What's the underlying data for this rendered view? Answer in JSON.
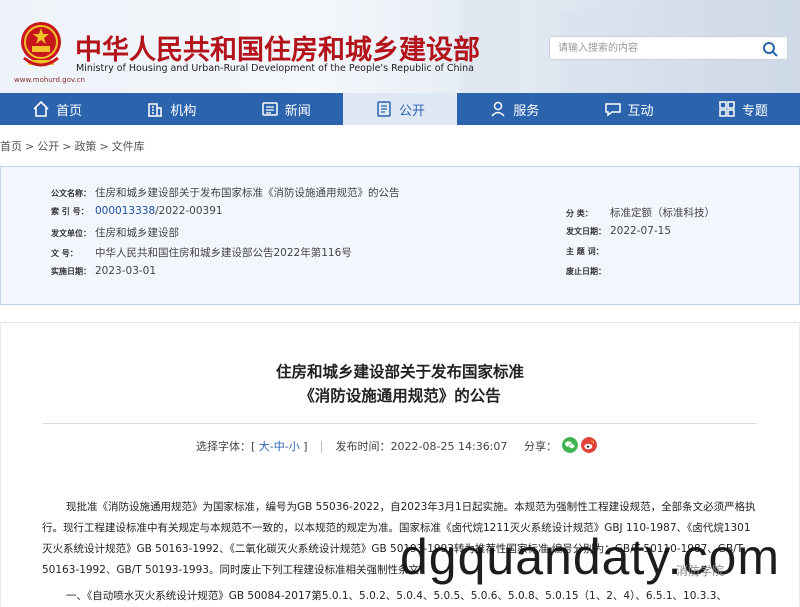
{
  "header": {
    "site_title": "中华人民共和国住房和城乡建设部",
    "site_subtitle": "Ministry of Housing and Urban-Rural Development of the People's Republic of China",
    "site_url": "www.mohurd.gov.cn",
    "search_placeholder": "请输入搜索的内容",
    "title_color": "#b3131a"
  },
  "nav": {
    "color": "#2b63ad",
    "items": [
      {
        "label": "首页",
        "icon": "home-icon"
      },
      {
        "label": "机构",
        "icon": "building-icon"
      },
      {
        "label": "新闻",
        "icon": "newspaper-icon"
      },
      {
        "label": "公开",
        "icon": "document-icon",
        "active": true
      },
      {
        "label": "服务",
        "icon": "service-icon"
      },
      {
        "label": "互动",
        "icon": "chat-icon"
      },
      {
        "label": "专题",
        "icon": "topic-icon"
      }
    ]
  },
  "breadcrumb": [
    "首页",
    "公开",
    "政策",
    "文件库"
  ],
  "info": {
    "doc_name_label": "公文名称：",
    "doc_name": "住房和城乡建设部关于发布国家标准《消防设施通用规范》的公告",
    "index_label": "索 引 号：",
    "index_num": "000013338",
    "index_rest": "/2022-00391",
    "issuer_label": "发文单位：",
    "issuer": "住房和城乡建设部",
    "docno_label": "文    号：",
    "docno": "中华人民共和国住房和城乡建设部公告2022年第116号",
    "effective_label": "实施日期：",
    "effective": "2023-03-01",
    "category_label": "分    类：",
    "category": "标准定额（标准科技）",
    "pubdate_label": "发文日期：",
    "pubdate": "2022-07-15",
    "subject_label": "主 题 词：",
    "subject": "",
    "abolish_label": "废止日期：",
    "abolish": ""
  },
  "article": {
    "title_line1": "住房和城乡建设部关于发布国家标准",
    "title_line2": "《消防设施通用规范》的公告",
    "font_label": "选择字体：[",
    "font_large": "大",
    "font_medium": "中",
    "font_small": "小",
    "font_close": "]",
    "time_label": "发布时间：",
    "time": "2022-08-25 14:36:07",
    "share_label": "分享：",
    "share_icons": [
      "wechat-icon",
      "weibo-icon"
    ],
    "para1": "现批准《消防设施通用规范》为国家标准，编号为GB 55036-2022，自2023年3月1日起实施。本规范为强制性工程建设规范，全部条文必须严格执行。现行工程建设标准中有关规定与本规范不一致的，以本规范的规定为准。国家标准《卤代烷1211灭火系统设计规范》GBJ 110-1987、《卤代烷1301灭火系统设计规范》GB 50163-1992、《二氧化碳灭火系统设计规范》GB 50193-1993转为推荐性国家标准,编号分别为：GB/T 50110-1987、GB/T 50163-1992、GB/T 50193-1993。同时废止下列工程建设标准相关强制性条文：",
    "item1": "一、《自动喷水灭火系统设计规范》GB 50084-2017第5.0.1、5.0.2、5.0.4、5.0.5、5.0.6、5.0.8、5.0.15（1、2、4）、6.5.1、10.3.3、"
  },
  "watermark": {
    "text": "dgquandaty.com",
    "badge": "消防学院"
  }
}
